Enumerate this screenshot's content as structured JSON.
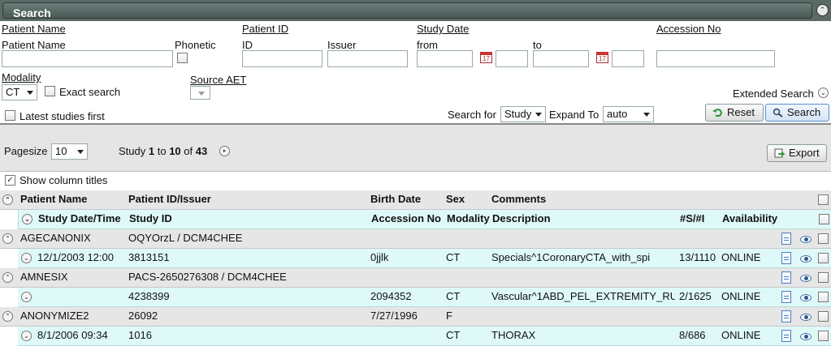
{
  "panel": {
    "title": "Search"
  },
  "search": {
    "patient_name_section": "Patient Name",
    "patient_name_label": "Patient Name",
    "phonetic_label": "Phonetic",
    "patient_id_section": "Patient ID",
    "id_label": "ID",
    "issuer_label": "Issuer",
    "study_date_section": "Study Date",
    "from_label": "from",
    "to_label": "to",
    "accession_section": "Accession No",
    "modality_section": "Modality",
    "modality_value": "CT",
    "exact_search_label": "Exact search",
    "source_aet_section": "Source AET",
    "extended_search_label": "Extended Search",
    "latest_first_label": "Latest studies first",
    "search_for_label": "Search for",
    "search_for_value": "Study",
    "expand_to_label": "Expand To",
    "expand_to_value": "auto",
    "reset_label": "Reset",
    "search_label": "Search"
  },
  "paging": {
    "pagesize_label": "Pagesize",
    "pagesize_value": "10",
    "study_word": "Study",
    "from": "1",
    "to_word": "to",
    "to": "10",
    "of_word": "of",
    "total": "43",
    "export_label": "Export"
  },
  "show_titles_label": "Show column titles",
  "columns": {
    "patient": [
      "Patient Name",
      "Patient ID/Issuer",
      "Birth Date",
      "Sex",
      "Comments"
    ],
    "study": [
      "Study Date/Time",
      "Study ID",
      "Accession No",
      "Modality",
      "Description",
      "#S/#I",
      "Availability"
    ]
  },
  "rows": [
    {
      "patient": [
        "AGECANONIX",
        "OQYOrzL / DCM4CHEE",
        "",
        "",
        ""
      ],
      "study": [
        "12/1/2003 12:00",
        "3813151",
        "0jjlk",
        "CT",
        "Specials^1CoronaryCTA_with_spi",
        "13/1110",
        "ONLINE"
      ]
    },
    {
      "patient": [
        "AMNESIX",
        "PACS-2650276308 / DCM4CHEE",
        "",
        "",
        ""
      ],
      "study": [
        "",
        "4238399",
        "2094352",
        "CT",
        "Vascular^1ABD_PEL_EXTREMITY_RU",
        "2/1625",
        "ONLINE"
      ]
    },
    {
      "patient": [
        "ANONYMIZE2",
        "26092",
        "7/27/1996",
        "F",
        ""
      ],
      "study": [
        "8/1/2006 09:34",
        "1016",
        "",
        "CT",
        "THORAX",
        "8/686",
        "ONLINE"
      ]
    }
  ],
  "icons": {
    "expand": "expand-icon",
    "details": "document-icon",
    "view": "eye-icon",
    "calendar": "calendar-icon"
  }
}
